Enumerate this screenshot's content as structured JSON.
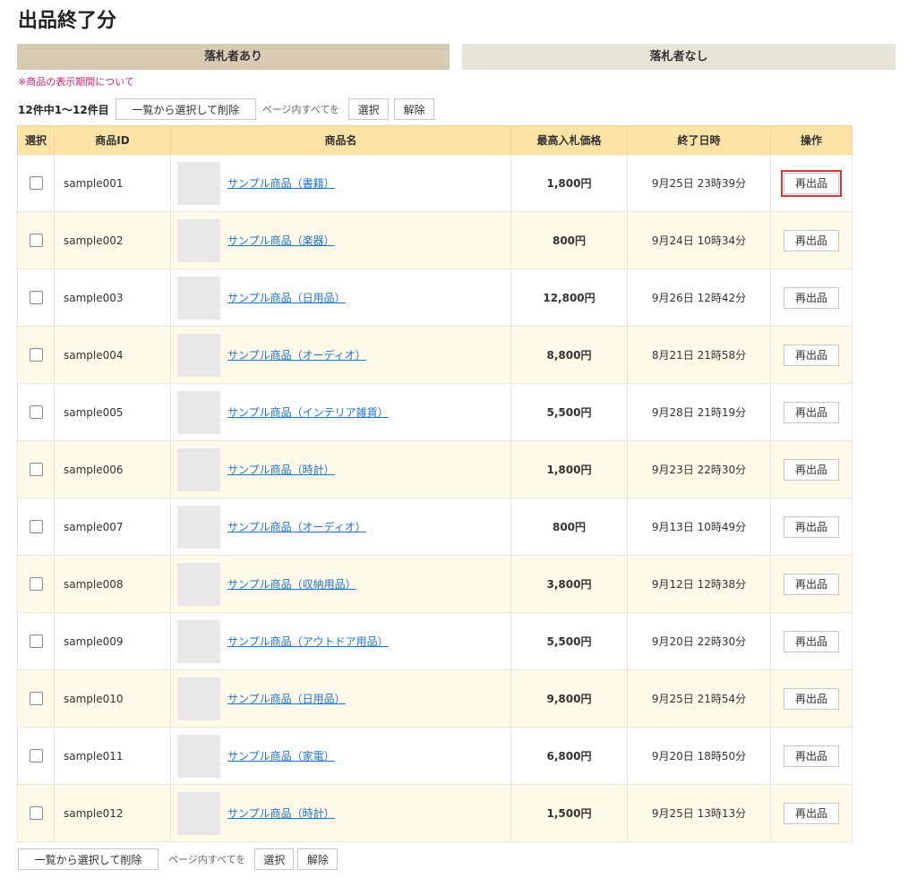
{
  "page_title": "出品終了分",
  "tabs": [
    {
      "label": "落札者あり",
      "active": true
    },
    {
      "label": "落札者なし",
      "active": false
    }
  ],
  "notice": "※商品の表示期間について",
  "toolbar": {
    "count_text": "12件中1〜12件目",
    "delete_label": "一覧から選択して削除",
    "page_all_text": "ページ内すべてを",
    "select_label": "選択",
    "clear_label": "解除"
  },
  "table": {
    "headers": {
      "select": "選択",
      "item_id": "商品ID",
      "item_name": "商品名",
      "max_bid": "最高入札価格",
      "end_date": "終了日時",
      "action": "操作"
    },
    "relist_label": "再出品",
    "rows": [
      {
        "id": "sample001",
        "name": "サンプル商品（書籍）",
        "price": "1,800円",
        "date": "9月25日 23時39分"
      },
      {
        "id": "sample002",
        "name": "サンプル商品（楽器）",
        "price": "800円",
        "date": "9月24日 10時34分"
      },
      {
        "id": "sample003",
        "name": "サンプル商品（日用品）",
        "price": "12,800円",
        "date": "9月26日 12時42分"
      },
      {
        "id": "sample004",
        "name": "サンプル商品（オーディオ）",
        "price": "8,800円",
        "date": "8月21日 21時58分"
      },
      {
        "id": "sample005",
        "name": "サンプル商品（インテリア雑貨）",
        "price": "5,500円",
        "date": "9月28日 21時19分"
      },
      {
        "id": "sample006",
        "name": "サンプル商品（時計）",
        "price": "1,800円",
        "date": "9月23日 22時30分"
      },
      {
        "id": "sample007",
        "name": "サンプル商品（オーディオ）",
        "price": "800円",
        "date": "9月13日 10時49分"
      },
      {
        "id": "sample008",
        "name": "サンプル商品（収納用品）",
        "price": "3,800円",
        "date": "9月12日 12時38分"
      },
      {
        "id": "sample009",
        "name": "サンプル商品（アウトドア用品）",
        "price": "5,500円",
        "date": "9月20日 22時30分"
      },
      {
        "id": "sample010",
        "name": "サンプル商品（日用品）",
        "price": "9,800円",
        "date": "9月25日 21時54分"
      },
      {
        "id": "sample011",
        "name": "サンプル商品（家電）",
        "price": "6,800円",
        "date": "9月20日 18時50分"
      },
      {
        "id": "sample012",
        "name": "サンプル商品（時計）",
        "price": "1,500円",
        "date": "9月25日 13時13分"
      }
    ]
  }
}
